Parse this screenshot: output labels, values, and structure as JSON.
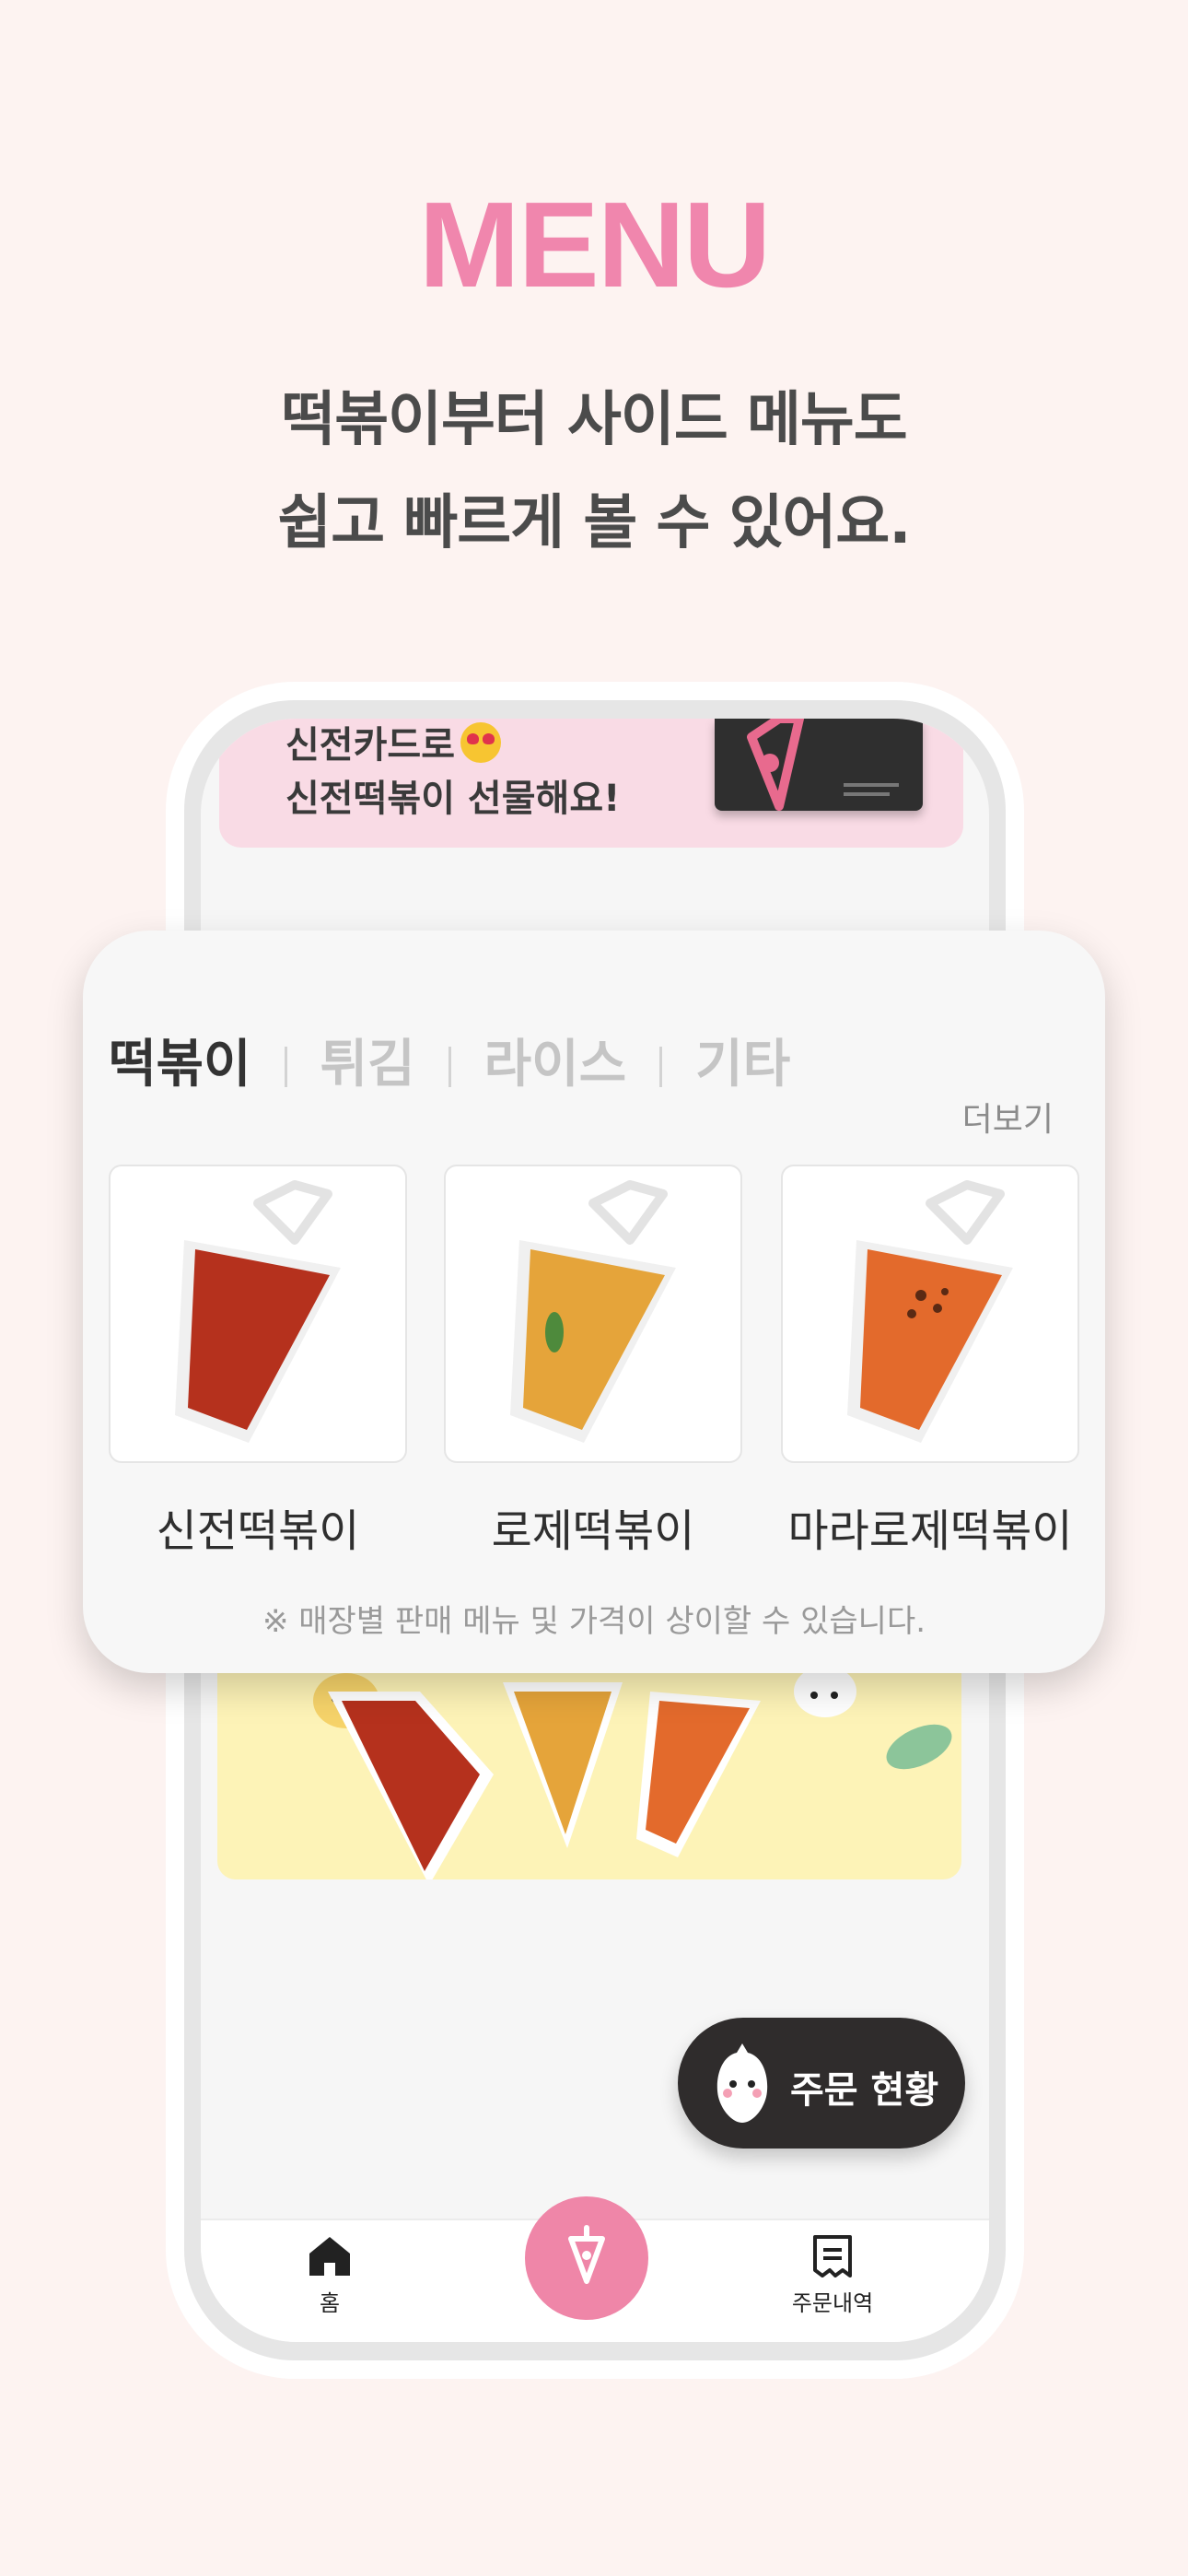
{
  "headline": "MENU",
  "subtitle": [
    "떡볶이부터 사이드 메뉴도",
    "쉽고 빠르게 볼 수 있어요."
  ],
  "banner": {
    "line1": "신전카드로",
    "line2": "신전떡볶이 선물해요!"
  },
  "categories": [
    "떡볶이",
    "튀김",
    "라이스",
    "기타"
  ],
  "more_label": "더보기",
  "menu_items": [
    {
      "name": "신전떡볶이",
      "sauce_color": "#b5311d"
    },
    {
      "name": "로제떡볶이",
      "sauce_color": "#e5a43a"
    },
    {
      "name": "마라로제떡볶이",
      "sauce_color": "#e36a2c"
    }
  ],
  "notice": "※ 매장별 판매 메뉴 및 가격이 상이할 수 있습니다.",
  "order_status_label": "주문 현황",
  "tabbar": {
    "home_label": "홈",
    "orders_label": "주문내역"
  },
  "colors": {
    "accent": "#f086ad",
    "background": "#fdf3f1",
    "dark": "#2f2c2c"
  }
}
